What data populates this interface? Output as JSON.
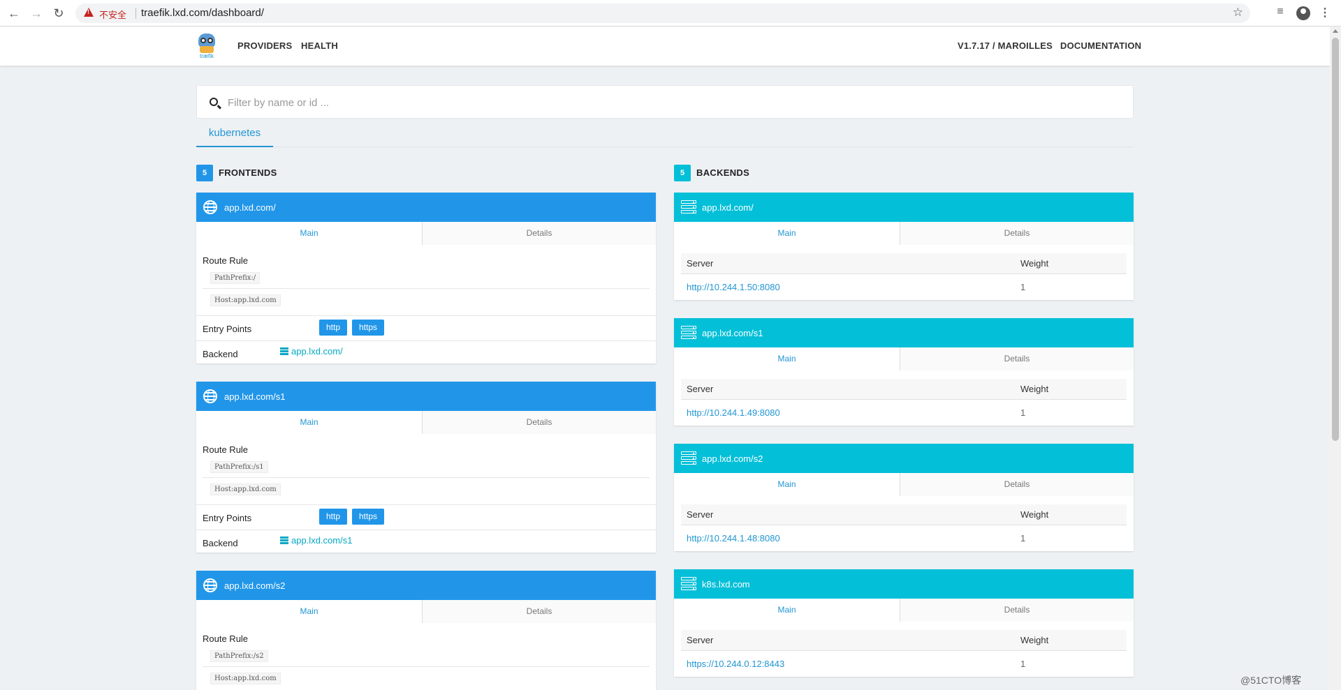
{
  "browser": {
    "insecure_label": "不安全",
    "url": "traefik.lxd.com/dashboard/"
  },
  "appbar": {
    "logo_text": "træfik",
    "nav": [
      "PROVIDERS",
      "HEALTH"
    ],
    "version": "V1.7.17 / MAROILLES",
    "documentation": "DOCUMENTATION"
  },
  "filter": {
    "placeholder": "Filter by name or id ..."
  },
  "provider_tab": "kubernetes",
  "frontends": {
    "count": "5",
    "title": "FRONTENDS",
    "tabs": [
      "Main",
      "Details"
    ],
    "route_rule_label": "Route Rule",
    "entry_points_label": "Entry Points",
    "backend_label": "Backend",
    "items": [
      {
        "name": "app.lxd.com/",
        "rules": [
          "PathPrefix:/",
          "Host:app.lxd.com"
        ],
        "entry_points": [
          "http",
          "https"
        ],
        "backend": "app.lxd.com/"
      },
      {
        "name": "app.lxd.com/s1",
        "rules": [
          "PathPrefix:/s1",
          "Host:app.lxd.com"
        ],
        "entry_points": [
          "http",
          "https"
        ],
        "backend": "app.lxd.com/s1"
      },
      {
        "name": "app.lxd.com/s2",
        "rules": [
          "PathPrefix:/s2",
          "Host:app.lxd.com"
        ]
      }
    ]
  },
  "backends": {
    "count": "5",
    "title": "BACKENDS",
    "tabs": [
      "Main",
      "Details"
    ],
    "columns": [
      "Server",
      "Weight"
    ],
    "items": [
      {
        "name": "app.lxd.com/",
        "server": "http://10.244.1.50:8080",
        "weight": "1"
      },
      {
        "name": "app.lxd.com/s1",
        "server": "http://10.244.1.49:8080",
        "weight": "1"
      },
      {
        "name": "app.lxd.com/s2",
        "server": "http://10.244.1.48:8080",
        "weight": "1"
      },
      {
        "name": "k8s.lxd.com",
        "server": "https://10.244.0.12:8443",
        "weight": "1"
      }
    ]
  },
  "watermark": "@51CTO博客",
  "colors": {
    "frontend": "#2196e9",
    "backend": "#04bfd8",
    "accent": "#2196d3"
  }
}
